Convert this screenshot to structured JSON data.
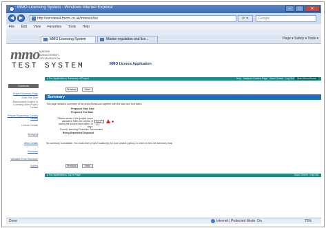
{
  "window": {
    "title": "MMO Licensing System - Windows Internet Explorer",
    "buttons": [
      "–",
      "□",
      "✕"
    ]
  },
  "browser": {
    "address": "http://mmotest4.fmcm.co.uk/mmovirt/lsc",
    "search_placeholder": "Google",
    "menu": [
      "File",
      "Edit",
      "View",
      "Favorites",
      "Tools",
      "Help"
    ],
    "tabs": [
      "MMO Licensing System",
      "Marine regulation and lice..."
    ],
    "toolbar_right": "Page ▾  Safety ▾  Tools ▾"
  },
  "site": {
    "logo_text": "mmo",
    "logo_sub": [
      "MARINE",
      "MANAGEMENT",
      "ORGANISATION"
    ],
    "test_label": "TEST SYSTEM",
    "app_title": "MMO Licence Application",
    "top_bar_left": "▸ Pre-Application  ▸ Summary of Project",
    "top_bar_right": [
      "Help",
      "Instance Context Page",
      "Save/ Check",
      "Log Out"
    ],
    "top_bar_home": "Main Menu/Home",
    "bottom_bar_left": "▸ Pre-Application  ▸ Top of Page",
    "bottom_bar_right": [
      "Save/ Check",
      "Log Out"
    ]
  },
  "sidebar": {
    "header": "Contents",
    "items": [
      {
        "label": "Project Summary Page",
        "style": "link"
      },
      {
        "label": "Enter Site Stub",
        "style": "plain"
      },
      {
        "label": "Assessment/ Subject to Licensing other Project Details",
        "style": "plain"
      },
      {
        "label": "Prepare Supporting/ Contact Details",
        "style": "link"
      },
      {
        "label": "Licence Details",
        "style": "plain"
      },
      {
        "label": "Dredging",
        "style": "link"
      },
      {
        "label": "Other Details",
        "style": "link"
      },
      {
        "label": "Summary",
        "style": "link"
      },
      {
        "label": "Validation Error Summary",
        "style": "link"
      },
      {
        "label": "Submit",
        "style": "link"
      }
    ]
  },
  "main": {
    "previous_label": "Previous",
    "next_label": "Next",
    "summary_header": "Summary",
    "intro": "This page details a summary of the project sessions together with the start and end dates.",
    "start_label": "Proposed Start Date",
    "end_label": "Proposed End Date",
    "question": "Please advise if the project (once validated) fulfils the criteria of having the project start within 10 days:",
    "select_value": "Select One",
    "trial_label": "Found Licensing Protection Taxonomies",
    "being_label": "Being Deposited/ Disposed",
    "note": "No summary is available. You must enter project location(s) for your project (option) in order to view the summary map."
  },
  "status": {
    "left": "Done",
    "zone": "Internet | Protected Mode: On",
    "zoom": "75%"
  }
}
